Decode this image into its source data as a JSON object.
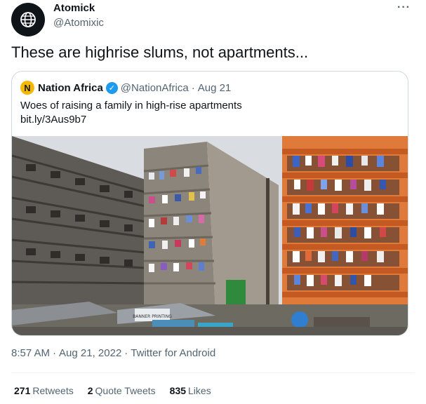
{
  "author": {
    "name": "Atomick",
    "handle": "@Atomixic"
  },
  "tweet_text": "These are highrise slums, not apartments...",
  "quoted": {
    "avatar_letter": "N",
    "name": "Nation Africa",
    "handle": "@NationAfrica",
    "dot": "·",
    "date": "Aug 21",
    "text": "Woes of raising a family in high-rise apartments",
    "link": "bit.ly/3Aus9b7",
    "image_sign_text": "BANNER PRINTING"
  },
  "meta": {
    "time": "8:57 AM",
    "date": "Aug 21, 2022",
    "client": "Twitter for Android",
    "sep": "·"
  },
  "stats": {
    "retweets_count": "271",
    "retweets_label": "Retweets",
    "quotes_count": "2",
    "quotes_label": "Quote Tweets",
    "likes_count": "835",
    "likes_label": "Likes"
  },
  "colors": {
    "verified": "#1d9bf0",
    "secondary_text": "#536471",
    "primary_text": "#0f1419"
  },
  "icons": {
    "avatar": "globe-icon",
    "more": "more-options-icon",
    "verified": "verified-badge-icon"
  }
}
